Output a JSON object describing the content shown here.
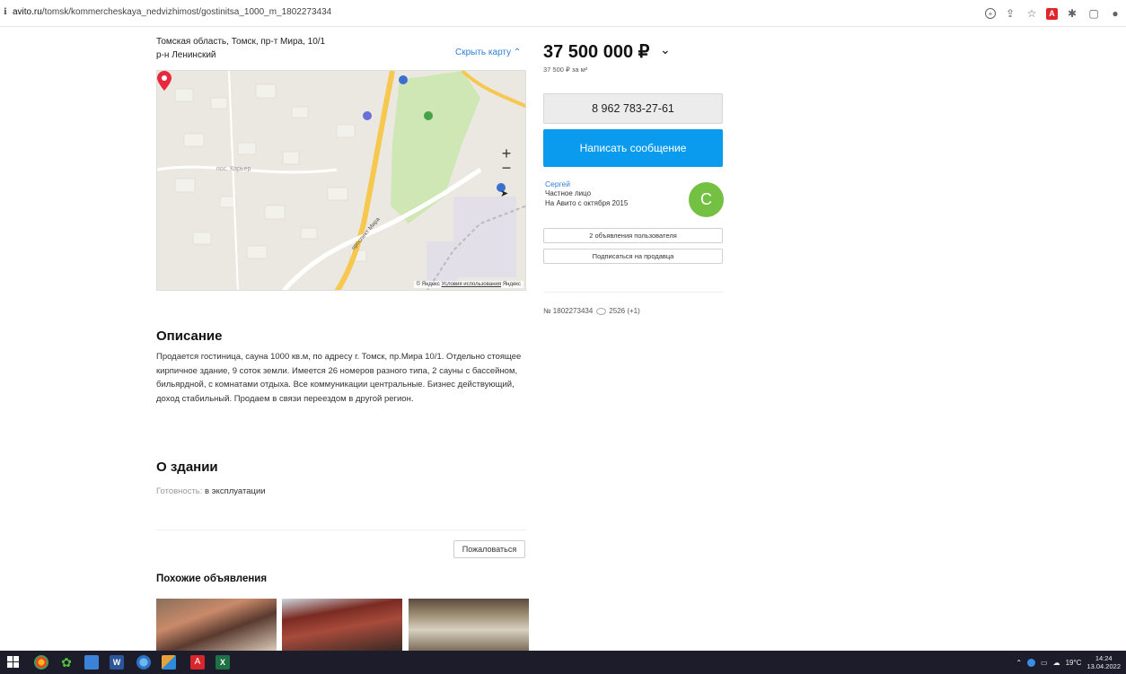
{
  "browser": {
    "url_host": "avito.ru",
    "url_path": "/tomsk/kommercheskaya_nedvizhimost/gostinitsa_1000_m_1802273434"
  },
  "listing": {
    "address_line1": "Томская область, Томск, пр-т Мира, 10/1",
    "address_line2": "р-н Ленинский",
    "hide_map_label": "Скрыть карту",
    "map": {
      "area_label": "пос. Карьер",
      "street_label": "проспект Мира",
      "footer_brand": "© Яндекс",
      "footer_terms": "Условия использования",
      "footer_logo": "Яндекс"
    },
    "description_heading": "Описание",
    "description": "Продается гостиница, сауна 1000 кв.м, по адресу г. Томск, пр.Мира 10/1. Отдельно стоящее кирпичное здание, 9 соток земли. Имеется 26 номеров разного типа, 2 сауны с бассейном, бильярдной, с комнатами отдыха. Все коммуникации центральные. Бизнес действующий, доход стабильный. Продаем в связи переездом в другой регион.",
    "building_heading": "О здании",
    "readiness_label": "Готовность:",
    "readiness_value": "в эксплуатации",
    "complain_label": "Пожаловаться",
    "similar_heading": "Похожие объявления"
  },
  "sidebar": {
    "price": "37 500 000 ₽",
    "price_per_sqm": "37 500 ₽ за м²",
    "phone": "8 962 783-27-61",
    "message_button": "Написать сообщение",
    "seller_name": "Сергей",
    "seller_type": "Частное лицо",
    "seller_since": "На Авито с октября 2015",
    "avatar_letter": "С",
    "user_ads_button": "2 объявления пользователя",
    "subscribe_button": "Подписаться на продавца",
    "listing_number": "№ 1802273434",
    "views": "2526 (+1)"
  },
  "taskbar": {
    "temperature": "19°C",
    "time": "14:24",
    "date": "13.04.2022"
  },
  "colors": {
    "accent_blue": "#0a9bef",
    "link_blue": "#2f7fd5",
    "avatar_green": "#73c043",
    "pin_red": "#e8283c"
  }
}
